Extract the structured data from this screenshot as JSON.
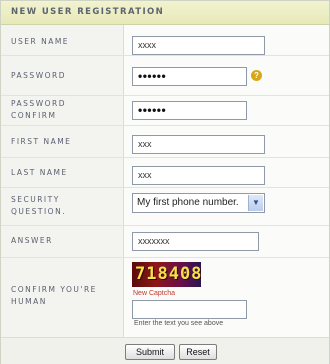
{
  "header": {
    "title": "NEW USER REGISTRATION"
  },
  "fields": {
    "user_name": {
      "label": "USER NAME",
      "value": "xxxx"
    },
    "password": {
      "label": "PASSWORD",
      "value": "••••••",
      "help_icon": "question-icon"
    },
    "password_confirm": {
      "label": "PASSWORD\nCONFIRM",
      "value": "••••••"
    },
    "first_name": {
      "label": "FIRST NAME",
      "value": "xxx"
    },
    "last_name": {
      "label": "LAST NAME",
      "value": "xxx"
    },
    "security_question": {
      "label": "SECURITY\nQUESTION.",
      "value": "My first phone number."
    },
    "answer": {
      "label": "ANSWER",
      "value": "xxxxxxx"
    },
    "captcha": {
      "label": "CONFIRM YOU'RE\nHUMAN",
      "image_text": "718408",
      "new_link": "New Captcha",
      "value": "",
      "hint": "Enter the text you see above"
    }
  },
  "buttons": {
    "submit": "Submit",
    "reset": "Reset"
  },
  "colors": {
    "header_bg": "#eceebd",
    "label_bg": "#f3f3ef",
    "link": "#c0392b",
    "captcha_text": "#f4e24a"
  }
}
